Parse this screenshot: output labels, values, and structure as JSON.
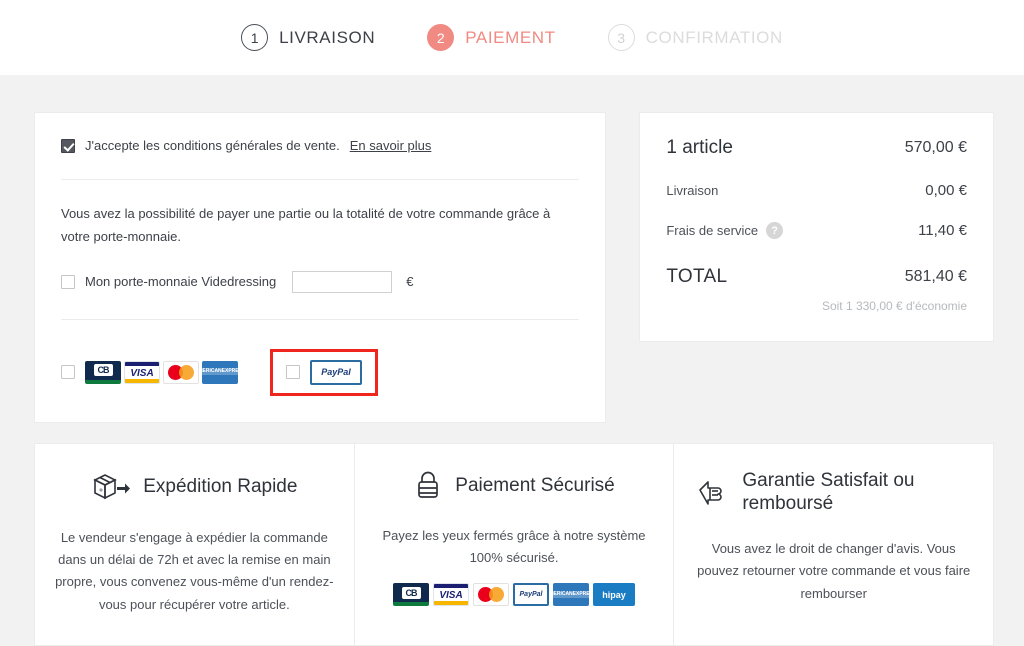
{
  "stepper": {
    "steps": [
      {
        "number": "1",
        "label": "LIVRAISON",
        "state": "done"
      },
      {
        "number": "2",
        "label": "PAIEMENT",
        "state": "active"
      },
      {
        "number": "3",
        "label": "CONFIRMATION",
        "state": "todo"
      }
    ],
    "active_color": "#f08a82",
    "inactive_color": "#dcdcdc"
  },
  "payment": {
    "cgv_text": "J'accepte les conditions générales de vente.",
    "cgv_link": "En savoir plus",
    "cgv_checked": true,
    "wallet_description": "Vous avez la possibilité de payer une partie ou la totalité de votre commande grâce à votre porte-monnaie.",
    "wallet_label": "Mon porte-monnaie Videdressing",
    "wallet_input_value": "",
    "wallet_currency": "€",
    "card_logos": [
      "CB",
      "VISA",
      "MasterCard",
      "American Express"
    ],
    "paypal_logo": "PayPal",
    "highlight_color": "#f0261e"
  },
  "summary": {
    "rows": [
      {
        "label": "1 article",
        "value": "570,00 €"
      },
      {
        "label": "Livraison",
        "value": "0,00 €"
      },
      {
        "label": "Frais de service",
        "value": "11,40 €"
      }
    ],
    "total_label": "TOTAL",
    "total_value": "581,40 €",
    "savings": "Soit 1 330,00 € d'économie",
    "help_glyph": "?"
  },
  "features": [
    {
      "icon": "shipping-box-icon",
      "title": "Expédition Rapide",
      "body": "Le vendeur s'engage à expédier la commande dans un délai de 72h et avec la remise en main propre, vous convenez vous-même d'un rendez-vous pour récupérer votre article."
    },
    {
      "icon": "padlock-icon",
      "title": "Paiement Sécurisé",
      "body": "Payez les yeux fermés grâce à notre système 100% sécurisé.",
      "logos": [
        "CB",
        "VISA",
        "MasterCard",
        "PayPal",
        "American Express",
        "hipay"
      ]
    },
    {
      "icon": "thumbs-up-icon",
      "title": "Garantie Satisfait ou remboursé",
      "body": "Vous avez le droit de changer d'avis. Vous pouvez retourner votre commande et vous faire rembourser"
    }
  ]
}
